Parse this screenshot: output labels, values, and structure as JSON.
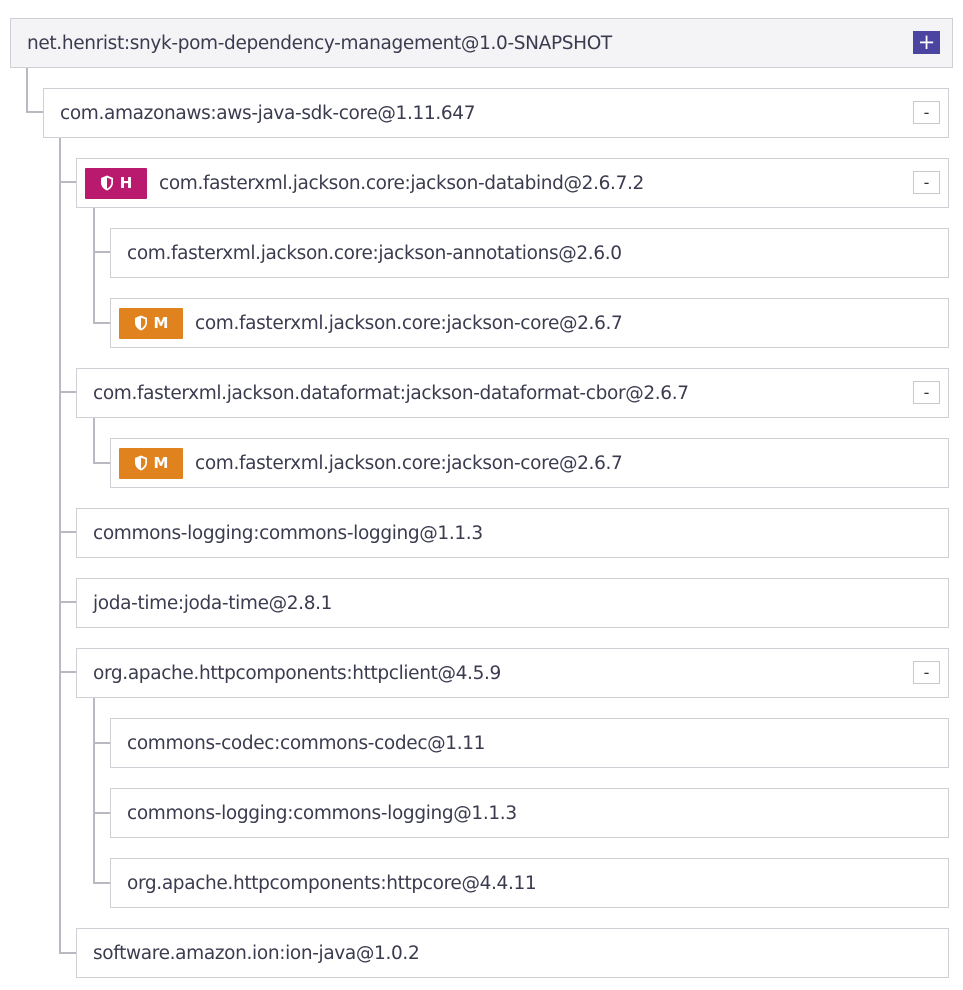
{
  "colors": {
    "high_severity": "#b91a6e",
    "medium_severity": "#e0831f",
    "expand_button": "#4b45a1",
    "connector": "#b9b9c2",
    "border": "#cfcfd6"
  },
  "tree": {
    "root": {
      "label": "net.henrist:snyk-pom-dependency-management@1.0-SNAPSHOT",
      "toggle": "+"
    },
    "aws_sdk_core": {
      "label": "com.amazonaws:aws-java-sdk-core@1.11.647",
      "toggle": "-"
    },
    "jackson_databind": {
      "label": "com.fasterxml.jackson.core:jackson-databind@2.6.7.2",
      "toggle": "-",
      "severity": "H",
      "severity_icon": "shield-icon"
    },
    "jackson_annotations": {
      "label": "com.fasterxml.jackson.core:jackson-annotations@2.6.0"
    },
    "jackson_core_1": {
      "label": "com.fasterxml.jackson.core:jackson-core@2.6.7",
      "severity": "M",
      "severity_icon": "shield-icon"
    },
    "jackson_cbor": {
      "label": "com.fasterxml.jackson.dataformat:jackson-dataformat-cbor@2.6.7",
      "toggle": "-"
    },
    "jackson_core_2": {
      "label": "com.fasterxml.jackson.core:jackson-core@2.6.7",
      "severity": "M",
      "severity_icon": "shield-icon"
    },
    "commons_logging_1": {
      "label": "commons-logging:commons-logging@1.1.3"
    },
    "joda_time": {
      "label": "joda-time:joda-time@2.8.1"
    },
    "httpclient": {
      "label": "org.apache.httpcomponents:httpclient@4.5.9",
      "toggle": "-"
    },
    "commons_codec": {
      "label": "commons-codec:commons-codec@1.11"
    },
    "commons_logging_2": {
      "label": "commons-logging:commons-logging@1.1.3"
    },
    "httpcore": {
      "label": "org.apache.httpcomponents:httpcore@4.4.11"
    },
    "ion_java": {
      "label": "software.amazon.ion:ion-java@1.0.2"
    }
  }
}
